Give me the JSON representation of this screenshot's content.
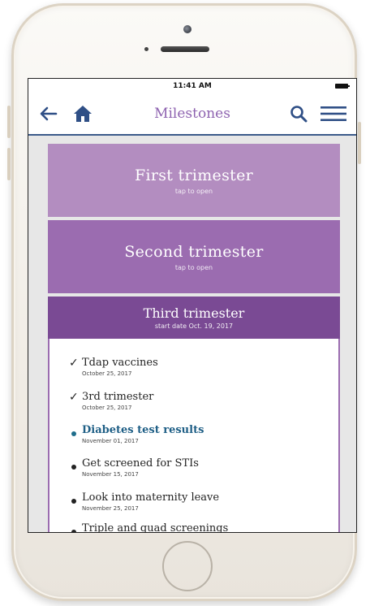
{
  "status_bar": {
    "time": "11:41 AM"
  },
  "nav": {
    "title": "Milestones",
    "back_icon": "arrow-left-icon",
    "home_icon": "home-icon",
    "search_icon": "search-icon",
    "menu_icon": "menu-icon"
  },
  "trimesters": [
    {
      "title": "First trimester",
      "subtitle": "tap to open"
    },
    {
      "title": "Second trimester",
      "subtitle": "tap to open"
    }
  ],
  "third_trimester": {
    "title": "Third trimester",
    "subtitle": "start date Oct. 19, 2017",
    "milestones": [
      {
        "title": "Tdap vaccines",
        "date": "October 25, 2017",
        "status": "done"
      },
      {
        "title": "3rd trimester",
        "date": "October 25, 2017",
        "status": "done"
      },
      {
        "title": "Diabetes test results",
        "date": "November 01, 2017",
        "status": "current"
      },
      {
        "title": "Get screened for STIs",
        "date": "November 15, 2017",
        "status": "upcoming"
      },
      {
        "title": "Look into maternity leave",
        "date": "November 25, 2017",
        "status": "upcoming"
      },
      {
        "title": "Triple and quad screenings",
        "date": "",
        "status": "upcoming"
      }
    ]
  },
  "colors": {
    "accent": "#8e63b0",
    "first_trimester": "#b38dc0",
    "second_trimester": "#9b6cb0",
    "third_trimester": "#7a4a94",
    "active_milestone": "#1f5f86",
    "nav_border": "#3b5a8a"
  }
}
